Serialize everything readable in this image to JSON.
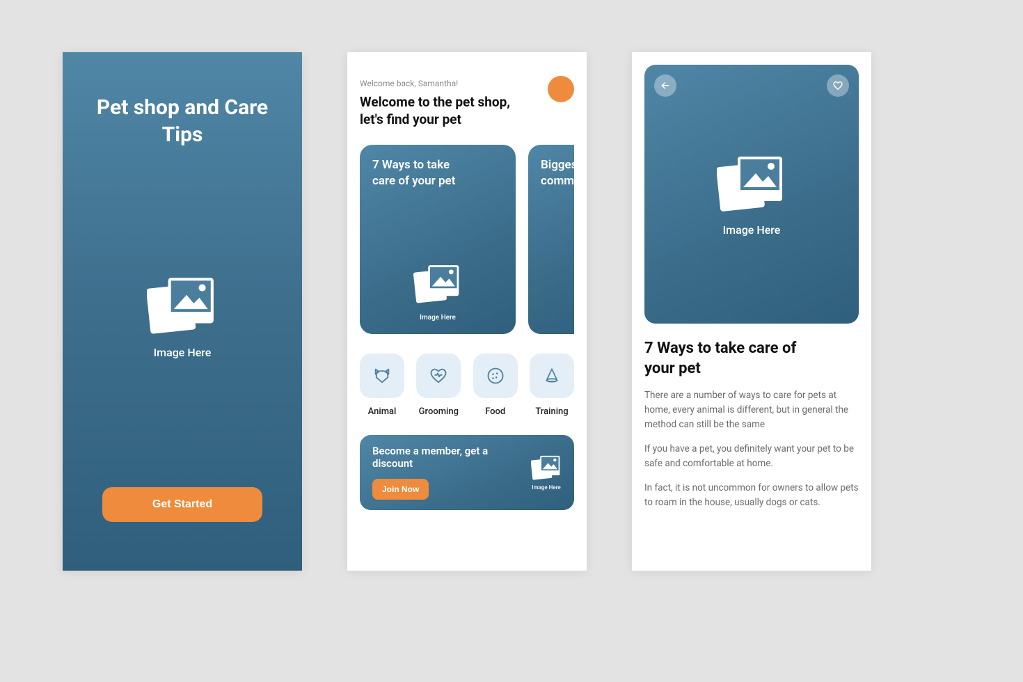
{
  "placeholder_label": "Image Here",
  "onboard": {
    "title": "Pet shop and Care Tips",
    "cta": "Get Started"
  },
  "home": {
    "greeting_small": "Welcome back, Samantha!",
    "greeting_big": "Welcome to the pet shop, let's find your pet",
    "cards": [
      {
        "title": "7 Ways to take care of your pet"
      },
      {
        "title": "Biggest commu"
      }
    ],
    "categories": [
      {
        "label": "Animal"
      },
      {
        "label": "Grooming"
      },
      {
        "label": "Food"
      },
      {
        "label": "Training"
      }
    ],
    "promo": {
      "title": "Become a member, get a discount",
      "cta": "Join Now"
    }
  },
  "article": {
    "title": "7 Ways to take care of your pet",
    "paragraphs": [
      "There are a number of ways to care for pets at home, every animal is different, but in general the method can still be the same",
      "If you have a pet, you definitely want your pet to be safe and comfortable at home.",
      "In fact, it is not uncommon for owners to allow pets to roam in the house, usually dogs or cats."
    ]
  }
}
